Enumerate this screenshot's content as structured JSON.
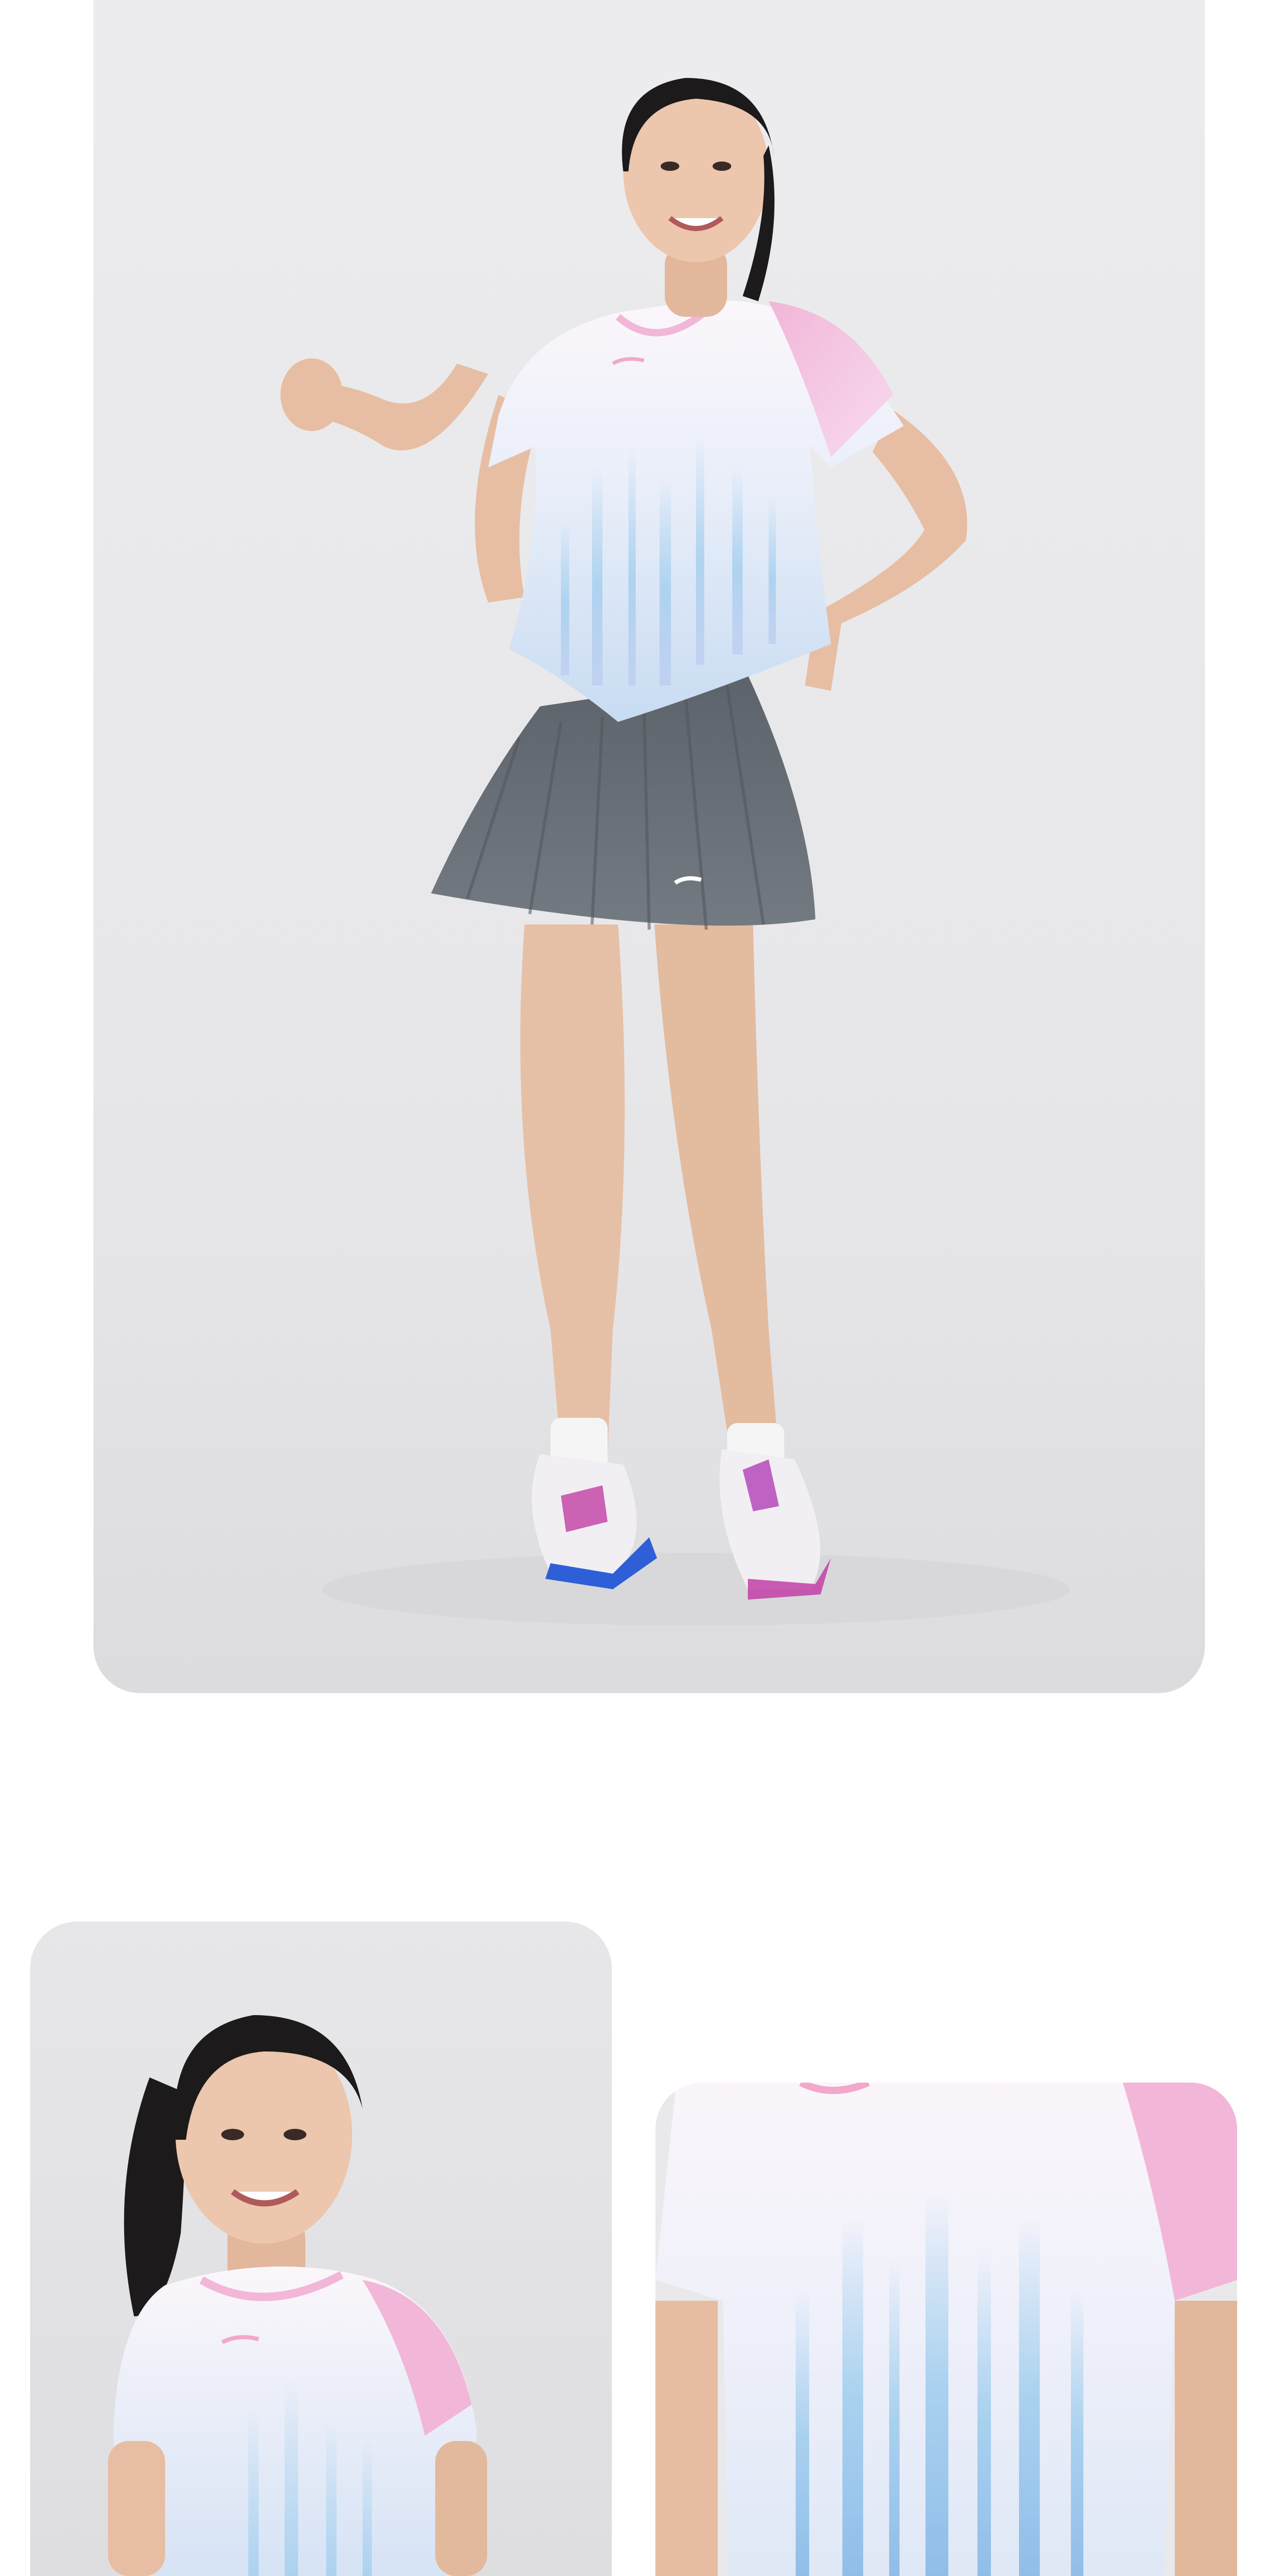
{
  "page": {
    "background": "#ffffff"
  },
  "photos": [
    {
      "id": "hero",
      "subject": "full-body",
      "backdrop": "#e6e6e8",
      "colors": {
        "shirt": "#f6f0f6",
        "shirt_accent_pink": "#f2b6d8",
        "shirt_stripes_blue": "#9fcdee",
        "skirt": "#6c7279",
        "skin": "#e8c2a8",
        "hair": "#1c1a1a",
        "shoes": "#f1eff3",
        "shoe_accent": "#c23fa4",
        "sole": "#2f5fd6"
      }
    },
    {
      "id": "portrait",
      "subject": "upper-body",
      "backdrop": "#e4e4e6"
    },
    {
      "id": "detail",
      "subject": "shirt-closeup",
      "backdrop": "#e9e9eb"
    }
  ]
}
